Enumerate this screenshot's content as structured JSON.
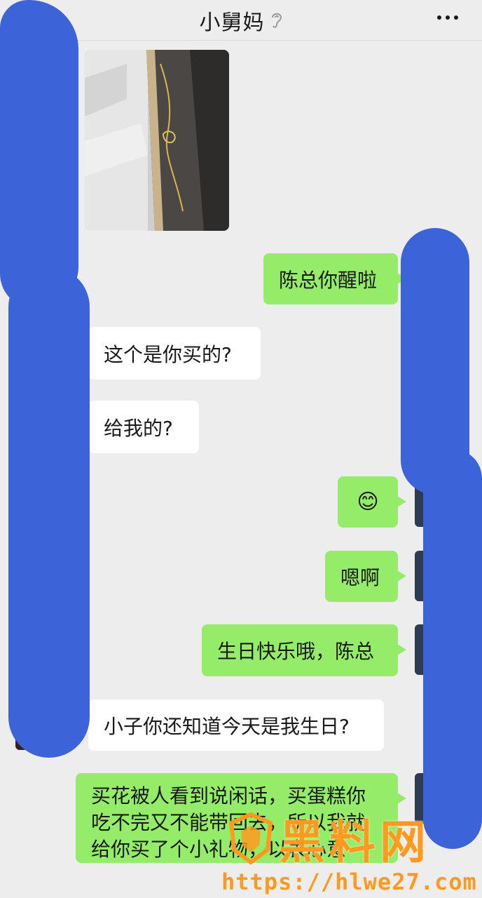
{
  "header": {
    "title": "小舅妈"
  },
  "messages": [
    {
      "from": "them",
      "type": "image"
    },
    {
      "from": "me",
      "text": "陈总你醒啦"
    },
    {
      "from": "them",
      "text": "这个是你买的?"
    },
    {
      "from": "them",
      "text": "给我的?"
    },
    {
      "from": "me",
      "text": "😊"
    },
    {
      "from": "me",
      "text": "嗯啊"
    },
    {
      "from": "me",
      "text": "生日快乐哦，陈总"
    },
    {
      "from": "them",
      "text": "小子你还知道今天是我生日?"
    },
    {
      "from": "me",
      "text": "买花被人看到说闲话，买蛋糕你吃不完又不能带回去，所以我就给你买了个小礼物，以表心意"
    }
  ],
  "watermark": {
    "brand": "黑料网",
    "url": "https://hlwe27.com"
  },
  "colors": {
    "me_bubble": "#95ec69",
    "them_bubble": "#ffffff",
    "background": "#ededed",
    "scribble": "#3d63d8"
  }
}
